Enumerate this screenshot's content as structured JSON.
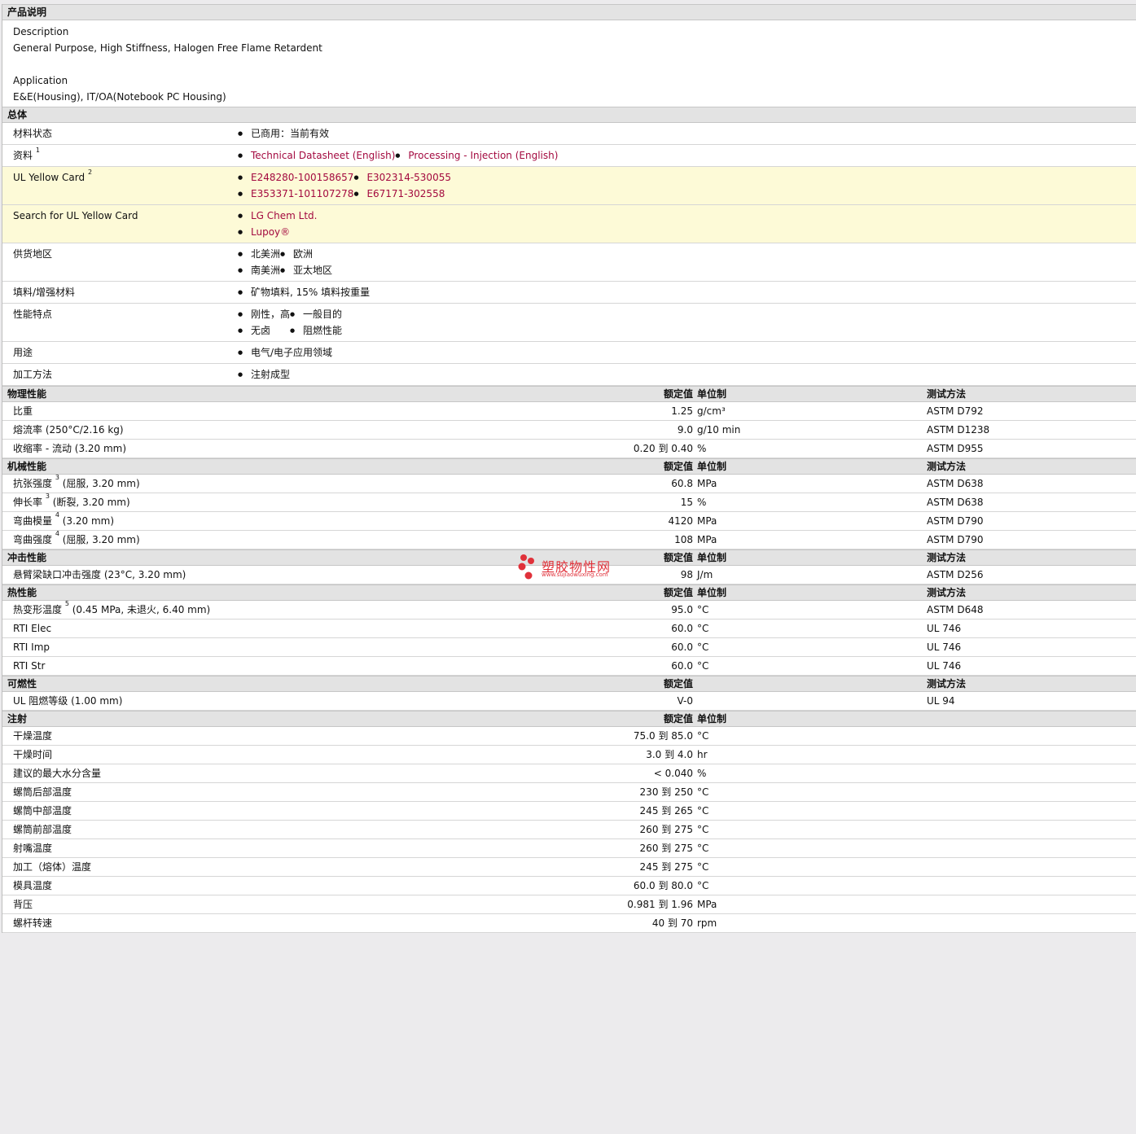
{
  "desc_section": {
    "title": "产品说明",
    "desc_label": "Description",
    "desc_value": "General Purpose, High Stiffness, Halogen Free Flame Retardent",
    "app_label": "Application",
    "app_value": "E&E(Housing), IT/OA(Notebook PC Housing)"
  },
  "general": {
    "title": "总体",
    "rows": [
      {
        "label": "材料状态",
        "col1": [
          "已商用：当前有效"
        ],
        "col2": []
      },
      {
        "label": "资料",
        "sup": "1",
        "col1": [
          "Technical Datasheet (English)"
        ],
        "col2": [
          "Processing - Injection (English)"
        ],
        "links": true
      },
      {
        "label": "UL Yellow Card",
        "sup": "2",
        "col1": [
          "E248280-100158657",
          "E353371-101107278"
        ],
        "col2": [
          "E302314-530055",
          "E67171-302558"
        ],
        "links": true,
        "yellow": true
      },
      {
        "label": "Search for UL Yellow Card",
        "col1": [
          "LG Chem Ltd.",
          "Lupoy®"
        ],
        "col2": [],
        "links": true,
        "yellow": true
      },
      {
        "label": "供货地区",
        "col1": [
          "北美洲",
          "南美洲"
        ],
        "col2": [
          "欧洲",
          "亚太地区"
        ]
      },
      {
        "label": "填料/增强材料",
        "col1": [
          "矿物填料, 15% 填料按重量"
        ],
        "col2": []
      },
      {
        "label": "性能特点",
        "col1": [
          "刚性，高",
          "无卤"
        ],
        "col2": [
          "一般目的",
          "阻燃性能"
        ]
      },
      {
        "label": "用途",
        "col1": [
          "电气/电子应用领域"
        ],
        "col2": []
      },
      {
        "label": "加工方法",
        "col1": [
          "注射成型"
        ],
        "col2": []
      }
    ]
  },
  "headers": {
    "value": "额定值",
    "unit": "单位制",
    "test": "测试方法"
  },
  "prop_sections": [
    {
      "title": "物理性能",
      "show_unit": true,
      "show_test": true,
      "rows": [
        {
          "label": "比重",
          "value": "1.25",
          "unit": "g/cm³",
          "test": "ASTM D792"
        },
        {
          "label": "熔流率  (250°C/2.16 kg)",
          "value": "9.0",
          "unit": "g/10 min",
          "test": "ASTM D1238"
        },
        {
          "label": "收缩率  - 流动  (3.20 mm)",
          "value": "0.20 到  0.40",
          "unit": "%",
          "test": "ASTM D955"
        }
      ]
    },
    {
      "title": "机械性能",
      "show_unit": true,
      "show_test": true,
      "rows": [
        {
          "label": "抗张强度",
          "sup": "3",
          "label2": " (屈服, 3.20 mm)",
          "value": "60.8",
          "unit": "MPa",
          "test": "ASTM D638"
        },
        {
          "label": "伸长率",
          "sup": "3",
          "label2": " (断裂, 3.20 mm)",
          "value": "15",
          "unit": "%",
          "test": "ASTM D638"
        },
        {
          "label": "弯曲模量",
          "sup": "4",
          "label2": " (3.20 mm)",
          "value": "4120",
          "unit": "MPa",
          "test": "ASTM D790"
        },
        {
          "label": "弯曲强度",
          "sup": "4",
          "label2": " (屈服, 3.20 mm)",
          "value": "108",
          "unit": "MPa",
          "test": "ASTM D790"
        }
      ]
    },
    {
      "title": "冲击性能",
      "show_unit": true,
      "show_test": true,
      "rows": [
        {
          "label": "悬臂梁缺口冲击强度  (23°C, 3.20 mm)",
          "value": "98",
          "unit": "J/m",
          "test": "ASTM D256"
        }
      ]
    },
    {
      "title": "热性能",
      "show_unit": true,
      "show_test": true,
      "rows": [
        {
          "label": "热变形温度",
          "sup": "5",
          "label2": " (0.45 MPa, 未退火, 6.40 mm)",
          "value": "95.0",
          "unit": "°C",
          "test": "ASTM D648"
        },
        {
          "label": "RTI Elec",
          "value": "60.0",
          "unit": "°C",
          "test": "UL 746"
        },
        {
          "label": "RTI Imp",
          "value": "60.0",
          "unit": "°C",
          "test": "UL 746"
        },
        {
          "label": "RTI Str",
          "value": "60.0",
          "unit": "°C",
          "test": "UL 746"
        }
      ]
    },
    {
      "title": "可燃性",
      "show_unit": false,
      "show_test": true,
      "rows": [
        {
          "label": "UL 阻燃等级  (1.00 mm)",
          "value": "V-0",
          "unit": "",
          "test": "UL 94"
        }
      ]
    },
    {
      "title": "注射",
      "show_unit": true,
      "show_test": false,
      "rows": [
        {
          "label": "干燥温度",
          "value": "75.0 到  85.0",
          "unit": "°C",
          "test": ""
        },
        {
          "label": "干燥时间",
          "value": "3.0 到  4.0",
          "unit": "hr",
          "test": ""
        },
        {
          "label": "建议的最大水分含量",
          "value": "< 0.040",
          "unit": "%",
          "test": ""
        },
        {
          "label": "螺筒后部温度",
          "value": "230 到  250",
          "unit": "°C",
          "test": ""
        },
        {
          "label": "螺筒中部温度",
          "value": "245 到  265",
          "unit": "°C",
          "test": ""
        },
        {
          "label": "螺筒前部温度",
          "value": "260 到  275",
          "unit": "°C",
          "test": ""
        },
        {
          "label": "射嘴温度",
          "value": "260 到  275",
          "unit": "°C",
          "test": ""
        },
        {
          "label": "加工（熔体）温度",
          "value": "245 到  275",
          "unit": "°C",
          "test": ""
        },
        {
          "label": "模具温度",
          "value": "60.0 到  80.0",
          "unit": "°C",
          "test": ""
        },
        {
          "label": "背压",
          "value": "0.981 到  1.96",
          "unit": "MPa",
          "test": ""
        },
        {
          "label": "螺杆转速",
          "value": "40 到  70",
          "unit": "rpm",
          "test": ""
        }
      ]
    }
  ],
  "watermark": {
    "text": "塑胶物性网",
    "url": "www.sujiaowuxing.com",
    "color": "#e0313a"
  }
}
